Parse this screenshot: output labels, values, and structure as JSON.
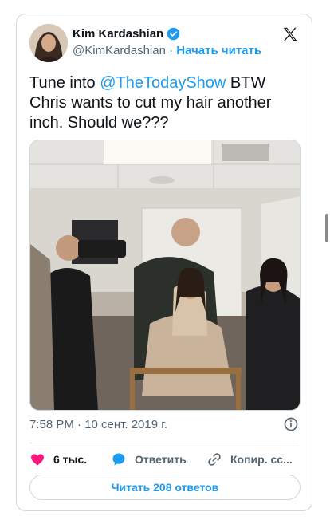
{
  "author": {
    "name": "Kim Kardashian",
    "handle": "@KimKardashian",
    "separator": "·",
    "follow_label": "Начать читать"
  },
  "tweet": {
    "text_prefix": "Tune into ",
    "mention": "@TheTodayShow",
    "text_suffix": " BTW Chris wants to cut my hair another inch. Should we???"
  },
  "meta": {
    "timestamp": "7:58 PM · 10 сент. 2019 г."
  },
  "actions": {
    "likes": "6 тыс.",
    "reply": "Ответить",
    "copy": "Копир. сс..."
  },
  "read_replies": "Читать 208 ответов",
  "icons": {
    "verified": "verified-badge-icon",
    "x_logo": "x-logo-icon",
    "info": "info-icon",
    "heart": "heart-icon",
    "reply": "reply-bubble-icon",
    "link": "link-icon"
  },
  "colors": {
    "accent": "#1d9bf0",
    "like": "#f91880",
    "muted": "#536471",
    "border": "#cfd9de"
  }
}
